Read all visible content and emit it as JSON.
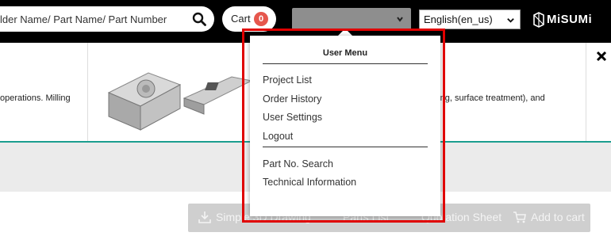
{
  "header": {
    "search": {
      "placeholder": "lder Name/ Part Name/ Part Number"
    },
    "cart": {
      "label": "Cart",
      "count": "0"
    },
    "language": {
      "selected": "English(en_us)"
    },
    "logo": {
      "text": "MiSUMi"
    }
  },
  "banner": {
    "left_text": "operations. Milling",
    "right_text": "nding, surface treatment), and"
  },
  "user_menu": {
    "title": "User Menu",
    "group1": [
      "Project List",
      "Order History",
      "User Settings",
      "Logout"
    ],
    "group2": [
      "Part No. Search",
      "Technical Information"
    ]
  },
  "actions": {
    "simple_3d": "Simple 3D Drawing",
    "parts_list": "Parts List",
    "quotation": "Quotation Sheet",
    "add_to_cart": "Add to cart"
  },
  "colors": {
    "header_bg": "#000000",
    "cart_badge": "#e6574d",
    "teal_accent": "#1b9e8f",
    "highlight": "#e00000"
  }
}
